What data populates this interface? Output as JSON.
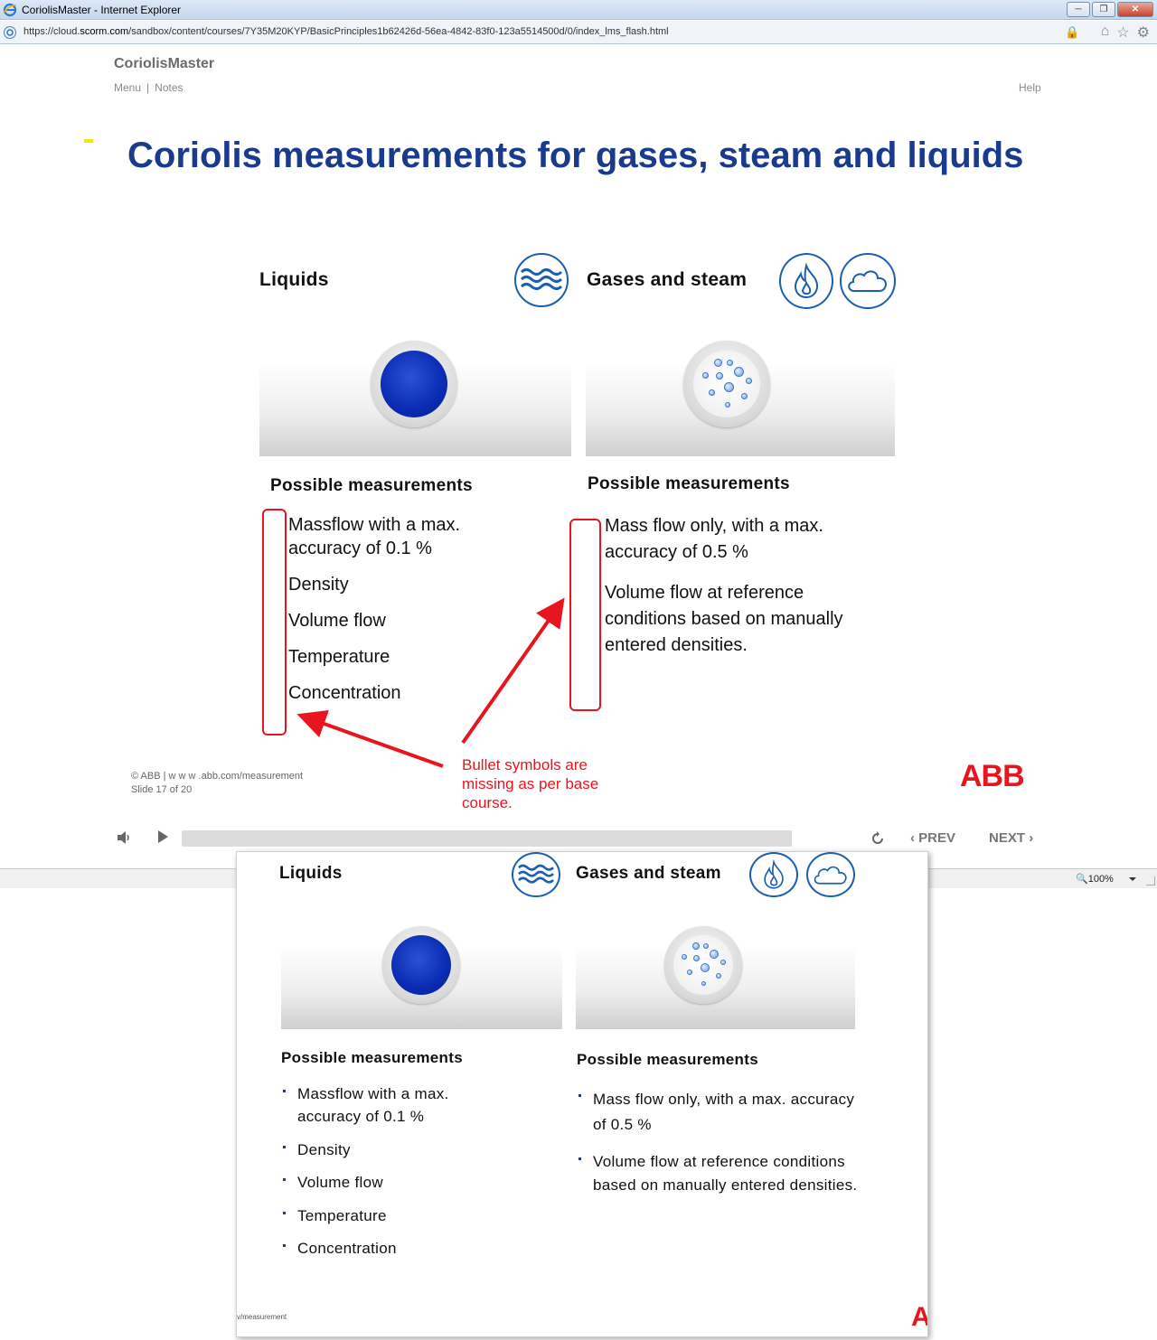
{
  "browser": {
    "window_title": "CoriolisMaster - Internet Explorer",
    "url_prefix": "https://cloud.",
    "url_domain": "scorm.com",
    "url_path": "/sandbox/content/courses/7Y35M20KYP/BasicPrinciples1b62426d-56ea-4842-83f0-123a5514500d/0/index_lms_flash.html",
    "zoom": "100%"
  },
  "course": {
    "name": "CoriolisMaster",
    "menu_label": "Menu",
    "separator": "|",
    "notes_label": "Notes",
    "help_label": "Help"
  },
  "slide": {
    "title": "Coriolis measurements for gases, steam and liquids",
    "liquids": {
      "heading": "Liquids",
      "measurements_title": "Possible measurements",
      "items": [
        "Massflow with a max. accuracy of 0.1 %",
        "Density",
        "Volume flow",
        "Temperature",
        "Concentration"
      ]
    },
    "gases": {
      "heading": "Gases and steam",
      "measurements_title": "Possible measurements",
      "items": [
        "Mass flow only, with a max. accuracy of 0.5 %",
        "Volume flow at reference conditions based on manually entered densities."
      ]
    },
    "footer_copyright": "© ABB | w w w .abb.com/measurement",
    "footer_slide": "Slide 17 of 20",
    "logo_text": "ABB"
  },
  "annotation": {
    "text": "Bullet symbols are missing as per base course.",
    "color": "#e8141e"
  },
  "player": {
    "prev_label": "PREV",
    "next_label": "NEXT",
    "progress": 0
  },
  "base_course": {
    "liquids_heading": "Liquids",
    "gases_heading": "Gases and steam",
    "liquids_measurements_title": "Possible measurements",
    "gases_measurements_title": "Possible measurements",
    "liquids_items": [
      "Massflow with a max. accuracy of 0.1 %",
      "Density",
      "Volume flow",
      "Temperature",
      "Concentration"
    ],
    "gases_items": [
      "Mass flow only, with a max. accuracy of 0.5 %",
      "Volume flow at reference conditions based on manually entered densities."
    ],
    "footer_fragment": "v/measurement",
    "logo_fragment": "A"
  },
  "colors": {
    "title_blue": "#1a3a8c",
    "icon_blue": "#1a5fb0",
    "abb_red": "#e8141e"
  },
  "icons": [
    "ie-logo-icon",
    "waves-icon",
    "flame-icon",
    "cloud-icon",
    "speaker-icon",
    "play-icon",
    "replay-icon",
    "chevron-left-icon",
    "chevron-right-icon",
    "home-icon",
    "star-icon",
    "gear-icon",
    "lock-icon",
    "zoom-icon"
  ]
}
